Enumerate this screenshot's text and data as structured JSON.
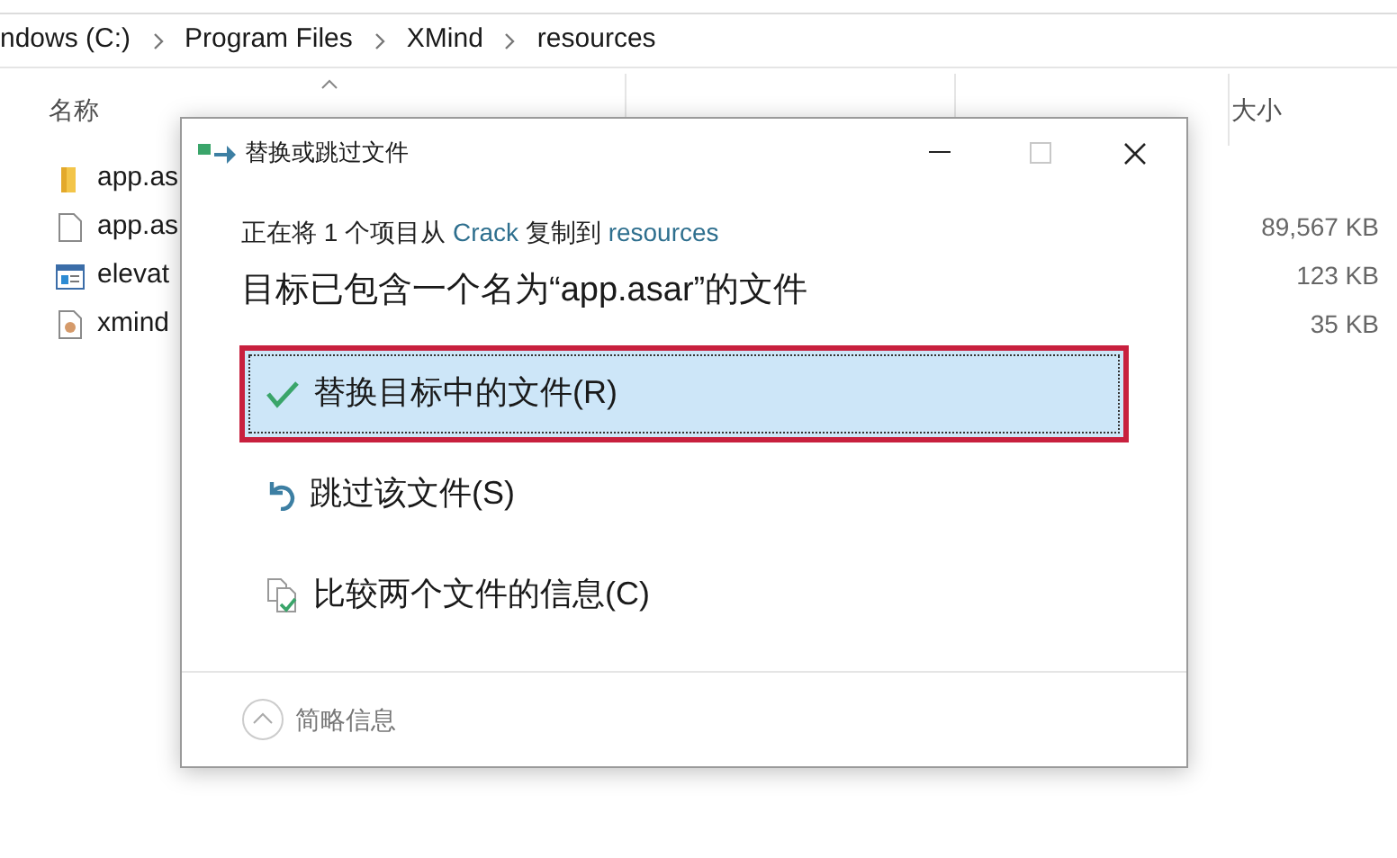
{
  "explorer": {
    "breadcrumb": [
      "ndows (C:)",
      "Program Files",
      "XMind",
      "resources"
    ],
    "columns": [
      {
        "label": "名称"
      },
      {
        "label": "大小"
      }
    ],
    "files": [
      {
        "name": "app.as",
        "kind": "folder"
      },
      {
        "name": "app.as",
        "kind": "file",
        "size": "89,567 KB"
      },
      {
        "name": "elevat",
        "kind": "app",
        "size": "123 KB"
      },
      {
        "name": "xmind",
        "kind": "script",
        "size": "35 KB"
      }
    ]
  },
  "dialog": {
    "title": "替换或跳过文件",
    "message": {
      "before": "正在将 1 个项目从 ",
      "source": "Crack",
      "middle": " 复制到 ",
      "destination": "resources"
    },
    "heading": "目标已包含一个名为“app.asar”的文件",
    "options": [
      {
        "label": "替换目标中的文件(R)",
        "kind": "replace",
        "selected": true
      },
      {
        "label": "跳过该文件(S)",
        "kind": "skip",
        "selected": false
      },
      {
        "label": "比较两个文件的信息(C)",
        "kind": "compare",
        "selected": false
      }
    ],
    "footer": "简略信息"
  }
}
